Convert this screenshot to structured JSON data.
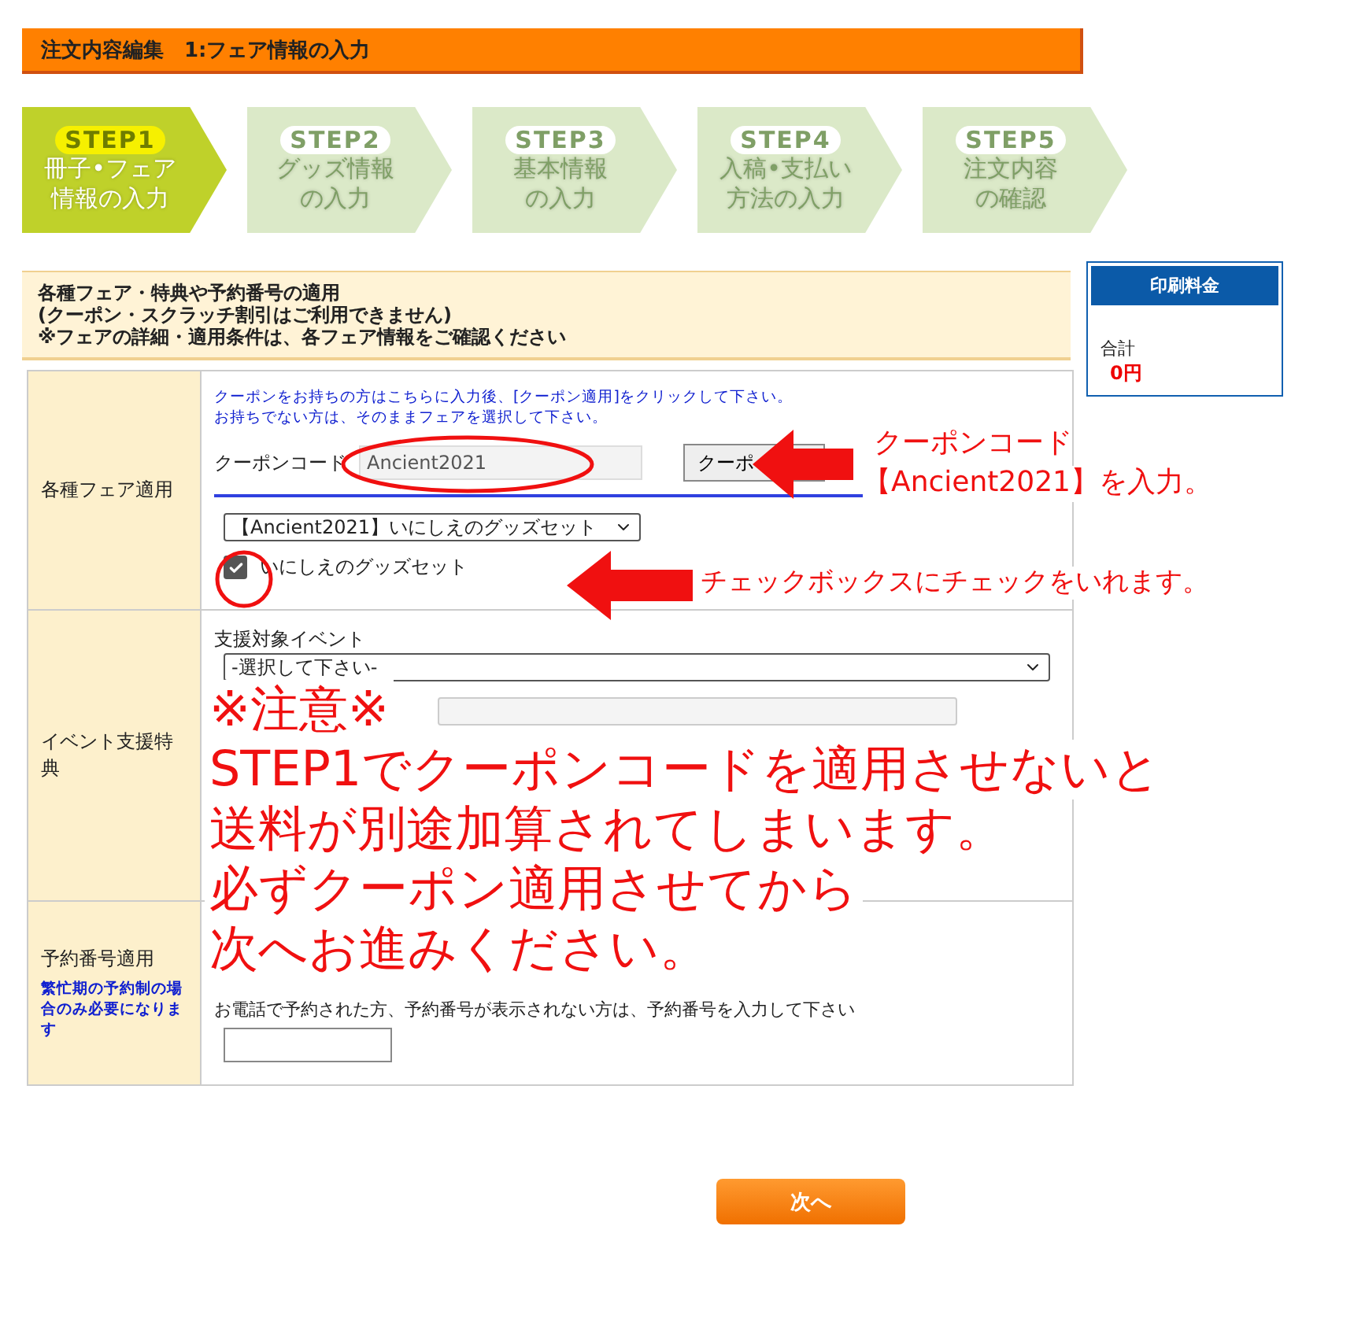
{
  "header": {
    "title": "注文内容編集　1:フェア情報の入力"
  },
  "steps": [
    {
      "label": "STEP1",
      "lines": [
        "冊子•フェア",
        "情報の入力"
      ],
      "selected": true
    },
    {
      "label": "STEP2",
      "lines": [
        "グッズ情報",
        "の入力"
      ],
      "selected": false
    },
    {
      "label": "STEP3",
      "lines": [
        "基本情報",
        "の入力"
      ],
      "selected": false
    },
    {
      "label": "STEP4",
      "lines": [
        "入稿•支払い",
        "方法の入力"
      ],
      "selected": false
    },
    {
      "label": "STEP5",
      "lines": [
        "注文内容",
        "の確認"
      ],
      "selected": false
    }
  ],
  "notice": {
    "lines": [
      "各種フェア・特典や予約番号の適用",
      "(クーポン・スクラッチ割引はご利用できません)",
      "※フェアの詳細・適用条件は、各フェア情報をご確認ください"
    ]
  },
  "price_box": {
    "title": "印刷料金",
    "total_label": "合計",
    "total_value": "0円"
  },
  "fair_row": {
    "label": "各種フェア適用",
    "hint_lines": [
      "クーポンをお持ちの方はこちらに入力後、[クーポン適用]をクリックして下さい。",
      "お持ちでない方は、そのままフェアを選択して下さい。"
    ],
    "coupon_label": "クーポンコード",
    "coupon_value": "Ancient2021",
    "coupon_button": "クーポ",
    "fair_select": "【Ancient2021】いにしえのグッズセット",
    "checkbox": {
      "label": "いにしえのグッズセット",
      "checked": true
    }
  },
  "event_row": {
    "label": "イベント支援特典",
    "event_label": "支援対象イベント",
    "event_select": "-選択して下さい-"
  },
  "reservation_row": {
    "label": "予約番号適用",
    "sub_label": "繁忙期の予約制の場合のみ必要になります",
    "phone_hint": "お電話で予約された方、予約番号が表示されない方は、予約番号を入力して下さい"
  },
  "next_button": "次へ",
  "annotations": {
    "coupon_note_lines": [
      "クーポンコード",
      "【Ancient2021】を入力。"
    ],
    "checkbox_note": "チェックボックスにチェックをいれます。",
    "warning_lines": [
      "※注意※",
      "STEP1でクーポンコードを適用させないと",
      "送料が別途加算されてしまいます。",
      "必ずクーポン適用させてから",
      "次へお進みください。"
    ]
  }
}
